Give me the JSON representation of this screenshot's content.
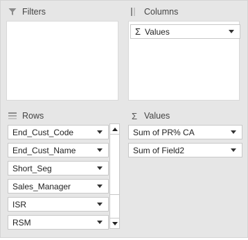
{
  "colors": {
    "panel_bg": "#e6e6e6",
    "drop_bg": "#ffffff",
    "field_border": "#c8c8c8",
    "text": "#262626"
  },
  "filters": {
    "title": "Filters",
    "icon": "filter-icon"
  },
  "columns": {
    "title": "Columns",
    "icon": "columns-icon",
    "items": [
      {
        "label": "Values",
        "icon": "sigma-icon"
      }
    ]
  },
  "rows": {
    "title": "Rows",
    "icon": "rows-icon",
    "items": [
      {
        "label": "End_Cust_Code"
      },
      {
        "label": "End_Cust_Name"
      },
      {
        "label": "Short_Seg"
      },
      {
        "label": "Sales_Manager"
      },
      {
        "label": "ISR"
      },
      {
        "label": "RSM"
      }
    ]
  },
  "values": {
    "title": "Values",
    "icon": "sigma-icon",
    "items": [
      {
        "label": "Sum of PR% CA"
      },
      {
        "label": "Sum of Field2"
      }
    ]
  }
}
